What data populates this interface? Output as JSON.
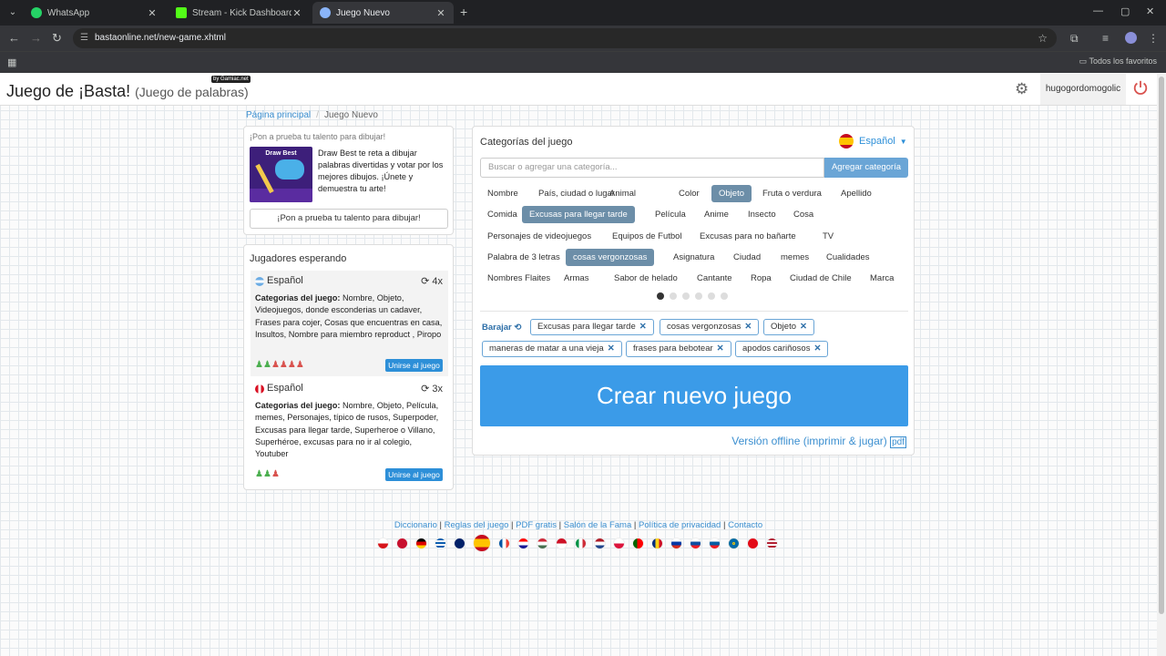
{
  "browser": {
    "tabs": [
      {
        "label": "WhatsApp",
        "icon": "whatsapp-icon",
        "color": "#25d366"
      },
      {
        "label": "Stream - Kick Dashboard",
        "icon": "kick-icon",
        "color": "#53fc18"
      },
      {
        "label": "Juego Nuevo",
        "icon": "globe-icon",
        "color": "#8ab4f8"
      }
    ],
    "url": "bastaonline.net/new-game.xhtml",
    "bookmarks_label": "Todos los favoritos"
  },
  "header": {
    "title": "Juego de ¡Basta!",
    "subtitle": "(Juego de palabras)",
    "badge": "by Gamiac.net",
    "username": "hugogordomogolic"
  },
  "breadcrumb": {
    "home": "Página principal",
    "current": "Juego Nuevo"
  },
  "promo": {
    "heading": "¡Pon a prueba tu talento para dibujar!",
    "image_title": "Draw Best",
    "text": "Draw Best te reta a dibujar palabras divertidas y votar por los mejores dibujos. ¡Únete y demuestra tu arte!",
    "button": "¡Pon a prueba tu talento para dibujar!"
  },
  "players": {
    "title": "Jugadores esperando",
    "games": [
      {
        "language": "Español",
        "rounds": "4x",
        "categories_label": "Categorias del juego:",
        "categories": "Nombre, Objeto, Videojuegos, donde esconderias un cadaver, Frases para cojer, Cosas que encuentras en casa, Insultos, Nombre para miembro reproduct , Piropo",
        "players_on": 2,
        "players_off": 4,
        "join": "Unirse al juego"
      },
      {
        "language": "Español",
        "rounds": "3x",
        "categories_label": "Categorias del juego:",
        "categories": "Nombre, Objeto, Película, memes, Personajes, típico de rusos, Superpoder, Excusas para llegar tarde, Superheroe o Villano, Superhéroe, excusas para no ir al colegio, Youtuber",
        "players_on": 2,
        "players_off": 1,
        "join": "Unirse al juego"
      }
    ]
  },
  "categories": {
    "title": "Categorías del juego",
    "language": "Español",
    "search_placeholder": "Buscar o agregar una categoría...",
    "add_button": "Agregar categoría",
    "chips": [
      [
        "Nombre",
        "País, ciudad o lugar",
        "Animal",
        "Color",
        "Objeto",
        "Fruta o verdura",
        "Apellido"
      ],
      [
        "Comida",
        "Excusas para llegar tarde",
        "Película",
        "Anime",
        "Insecto",
        "Cosa"
      ],
      [
        "Personajes de videojuegos",
        "Equipos de Futbol",
        "Excusas para no bañarte",
        "TV"
      ],
      [
        "Palabra de 3 letras",
        "cosas vergonzosas",
        "Asignatura",
        "Ciudad",
        "memes",
        "Cualidades"
      ],
      [
        "Nombres Flaites",
        "Armas",
        "Sabor de helado",
        "Cantante",
        "Ropa",
        "Ciudad de Chile",
        "Marca"
      ]
    ],
    "selected_chips": [
      "Objeto",
      "Excusas para llegar tarde",
      "cosas vergonzosas"
    ],
    "shuffle": "Barajar",
    "selected": [
      "Excusas para llegar tarde",
      "cosas vergonzosas",
      "Objeto",
      "maneras de matar a una vieja",
      "frases para bebotear",
      "apodos cariñosos"
    ],
    "page_dots": 6,
    "active_dot": 1
  },
  "create_button": "Crear nuevo juego",
  "offline_link": "Versión offline (imprimir & jugar)",
  "footer": {
    "links": [
      "Diccionario",
      "Reglas del juego",
      "PDF gratis",
      "Salón de la Fama",
      "Política de privacidad",
      "Contacto"
    ]
  },
  "colors": {
    "accent": "#3b9be8",
    "chip_selected": "#6c8ea8",
    "link": "#3b8fd0"
  }
}
